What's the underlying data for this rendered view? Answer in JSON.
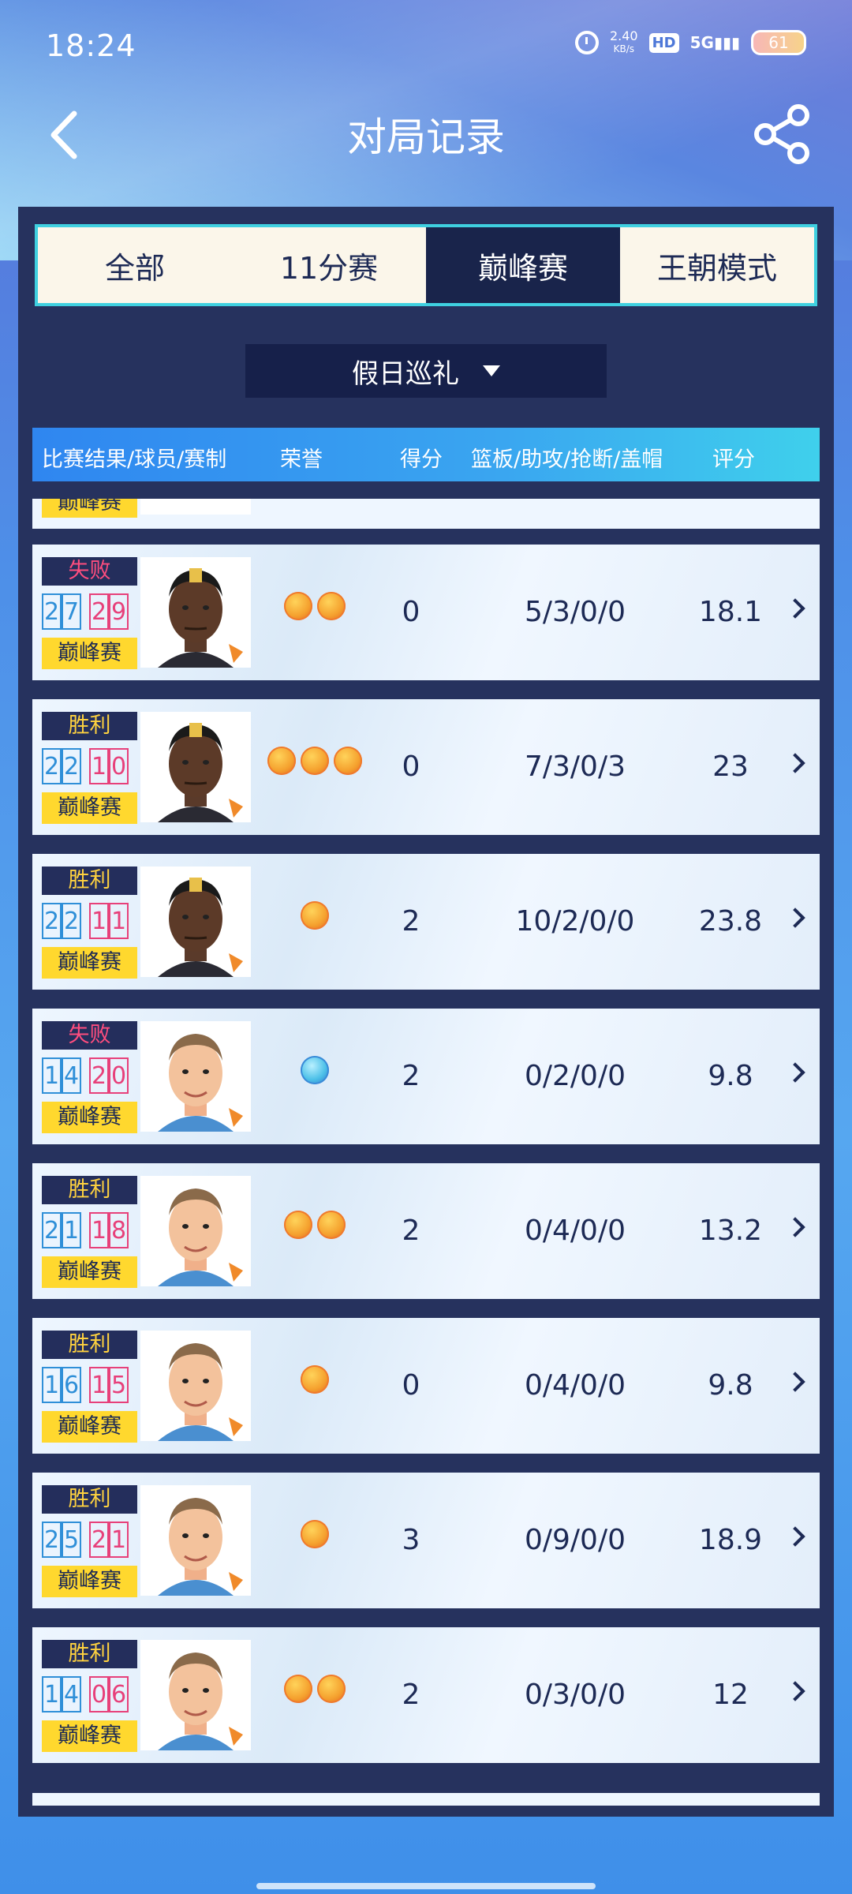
{
  "status_bar": {
    "time": "18:24",
    "net_speed": "2.40",
    "net_unit": "KB/s",
    "hd": "HD",
    "signal": "5G",
    "battery": "61",
    "icons": [
      "alarm-icon",
      "signal-icon",
      "battery-icon"
    ]
  },
  "nav": {
    "title": "对局记录",
    "back_icon": "back-chevron-icon",
    "share_icon": "share-icon"
  },
  "tabs": [
    {
      "label": "全部",
      "active": false
    },
    {
      "label": "11分赛",
      "active": false
    },
    {
      "label": "巅峰赛",
      "active": true
    },
    {
      "label": "王朝模式",
      "active": false
    }
  ],
  "filter": {
    "selected": "假日巡礼"
  },
  "columns": {
    "result": "比赛结果/球员/赛制",
    "honor": "荣誉",
    "points": "得分",
    "stats": "篮板/助攻/抢断/盖帽",
    "rating": "评分"
  },
  "partial_top_mode": "巅峰赛",
  "matches": [
    {
      "result": "失败",
      "outcome": "lose",
      "score_a": [
        "2",
        "7"
      ],
      "score_b": [
        "2",
        "9"
      ],
      "mode": "巅峰赛",
      "player": "dark",
      "honors": 2,
      "honor_color": "orange",
      "points": "0",
      "stats": "5/3/0/0",
      "rating": "18.1"
    },
    {
      "result": "胜利",
      "outcome": "win",
      "score_a": [
        "2",
        "2"
      ],
      "score_b": [
        "1",
        "0"
      ],
      "mode": "巅峰赛",
      "player": "dark",
      "honors": 3,
      "honor_color": "orange",
      "points": "0",
      "stats": "7/3/0/3",
      "rating": "23"
    },
    {
      "result": "胜利",
      "outcome": "win",
      "score_a": [
        "2",
        "2"
      ],
      "score_b": [
        "1",
        "1"
      ],
      "mode": "巅峰赛",
      "player": "dark",
      "honors": 1,
      "honor_color": "orange",
      "points": "2",
      "stats": "10/2/0/0",
      "rating": "23.8"
    },
    {
      "result": "失败",
      "outcome": "lose",
      "score_a": [
        "1",
        "4"
      ],
      "score_b": [
        "2",
        "0"
      ],
      "mode": "巅峰赛",
      "player": "light",
      "honors": 1,
      "honor_color": "blue",
      "points": "2",
      "stats": "0/2/0/0",
      "rating": "9.8"
    },
    {
      "result": "胜利",
      "outcome": "win",
      "score_a": [
        "2",
        "1"
      ],
      "score_b": [
        "1",
        "8"
      ],
      "mode": "巅峰赛",
      "player": "light",
      "honors": 2,
      "honor_color": "orange",
      "points": "2",
      "stats": "0/4/0/0",
      "rating": "13.2"
    },
    {
      "result": "胜利",
      "outcome": "win",
      "score_a": [
        "1",
        "6"
      ],
      "score_b": [
        "1",
        "5"
      ],
      "mode": "巅峰赛",
      "player": "light",
      "honors": 1,
      "honor_color": "orange",
      "points": "0",
      "stats": "0/4/0/0",
      "rating": "9.8"
    },
    {
      "result": "胜利",
      "outcome": "win",
      "score_a": [
        "2",
        "5"
      ],
      "score_b": [
        "2",
        "1"
      ],
      "mode": "巅峰赛",
      "player": "light",
      "honors": 1,
      "honor_color": "orange",
      "points": "3",
      "stats": "0/9/0/0",
      "rating": "18.9"
    },
    {
      "result": "胜利",
      "outcome": "win",
      "score_a": [
        "1",
        "4"
      ],
      "score_b": [
        "0",
        "6"
      ],
      "mode": "巅峰赛",
      "player": "light",
      "honors": 2,
      "honor_color": "orange",
      "points": "2",
      "stats": "0/3/0/0",
      "rating": "12"
    }
  ]
}
